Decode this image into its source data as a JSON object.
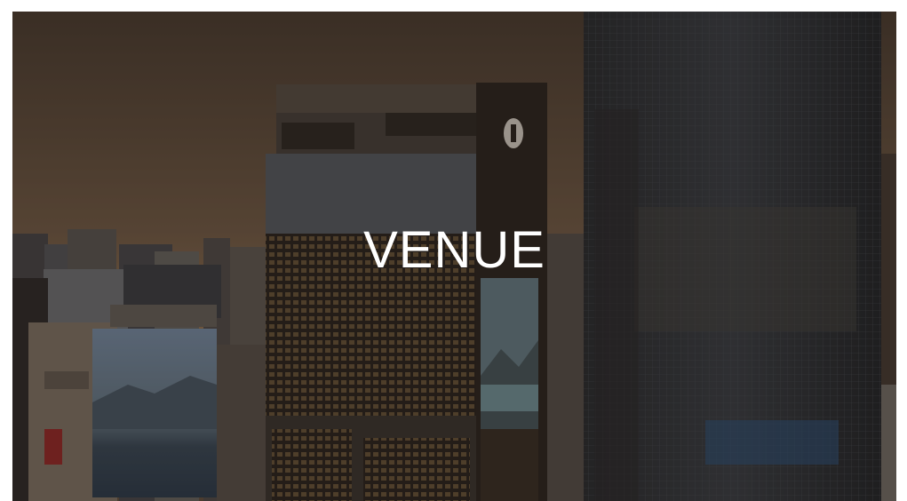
{
  "hero": {
    "title": "VENUE",
    "background_image": "city-skyline-hotel-towers-at-dusk",
    "colors": {
      "sky_top": "#5b4a3a",
      "sky_horizon": "#b8906a",
      "title_text": "#ffffff"
    }
  }
}
